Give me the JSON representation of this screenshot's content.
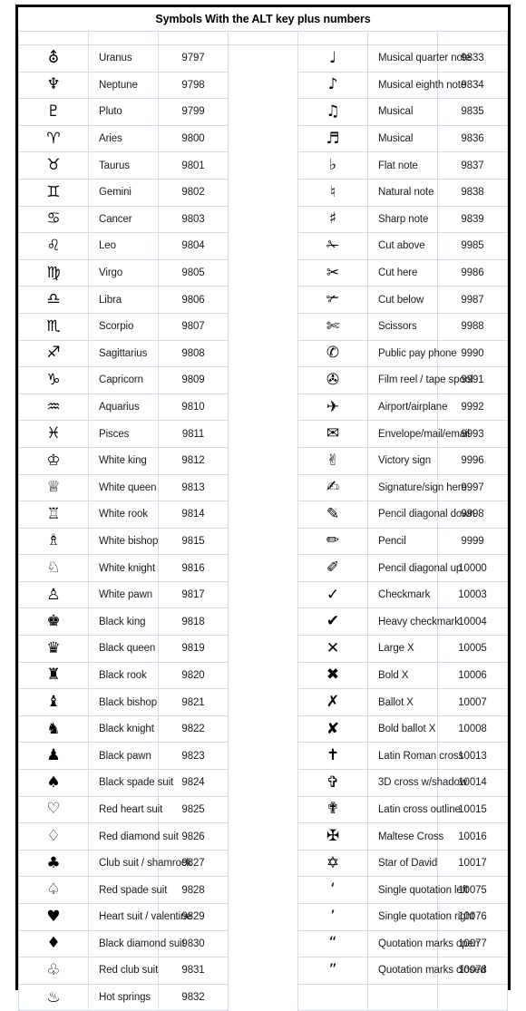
{
  "title": "Symbols With the ALT key plus numbers",
  "colors": {
    "frame": "#000000",
    "grid": "#d6dce5",
    "text": "#1a1a1a",
    "background": "#ffffff"
  },
  "columns": {
    "symbol_header": "",
    "name_header": "",
    "code_header": ""
  },
  "left_rows": [
    {
      "glyph": "⛢",
      "name": "Uranus",
      "code": "9797"
    },
    {
      "glyph": "♆",
      "name": "Neptune",
      "code": "9798"
    },
    {
      "glyph": "♇",
      "name": "Pluto",
      "code": "9799"
    },
    {
      "glyph": "♈",
      "name": "Aries",
      "code": "9800"
    },
    {
      "glyph": "♉",
      "name": "Taurus",
      "code": "9801"
    },
    {
      "glyph": "♊",
      "name": "Gemini",
      "code": "9802"
    },
    {
      "glyph": "♋",
      "name": "Cancer",
      "code": "9803"
    },
    {
      "glyph": "♌",
      "name": "Leo",
      "code": "9804"
    },
    {
      "glyph": "♍",
      "name": "Virgo",
      "code": "9805"
    },
    {
      "glyph": "♎",
      "name": "Libra",
      "code": "9806"
    },
    {
      "glyph": "♏",
      "name": "Scorpio",
      "code": "9807"
    },
    {
      "glyph": "♐",
      "name": "Sagittarius",
      "code": "9808"
    },
    {
      "glyph": "♑",
      "name": "Capricorn",
      "code": "9809"
    },
    {
      "glyph": "♒",
      "name": "Aquarius",
      "code": "9810"
    },
    {
      "glyph": "♓",
      "name": "Pisces",
      "code": "9811"
    },
    {
      "glyph": "♔",
      "name": "White king",
      "code": "9812"
    },
    {
      "glyph": "♕",
      "name": "White queen",
      "code": "9813"
    },
    {
      "glyph": "♖",
      "name": "White rook",
      "code": "9814"
    },
    {
      "glyph": "♗",
      "name": "White bishop",
      "code": "9815"
    },
    {
      "glyph": "♘",
      "name": "White knight",
      "code": "9816"
    },
    {
      "glyph": "♙",
      "name": "White pawn",
      "code": "9817"
    },
    {
      "glyph": "♚",
      "name": "Black king",
      "code": "9818"
    },
    {
      "glyph": "♛",
      "name": "Black queen",
      "code": "9819"
    },
    {
      "glyph": "♜",
      "name": "Black rook",
      "code": "9820"
    },
    {
      "glyph": "♝",
      "name": "Black bishop",
      "code": "9821"
    },
    {
      "glyph": "♞",
      "name": "Black knight",
      "code": "9822"
    },
    {
      "glyph": "♟",
      "name": "Black pawn",
      "code": "9823"
    },
    {
      "glyph": "♠",
      "name": "Black spade suit",
      "code": "9824"
    },
    {
      "glyph": "♡",
      "name": "Red heart suit",
      "code": "9825"
    },
    {
      "glyph": "♢",
      "name": "Red diamond suit",
      "code": "9826"
    },
    {
      "glyph": "♣",
      "name": "Club suit / shamrock",
      "code": "9827"
    },
    {
      "glyph": "♤",
      "name": "Red spade suit",
      "code": "9828"
    },
    {
      "glyph": "♥",
      "name": "Heart suit / valentine",
      "code": "9829"
    },
    {
      "glyph": "♦",
      "name": "Black diamond suit",
      "code": "9830"
    },
    {
      "glyph": "♧",
      "name": "Red club suit",
      "code": "9831"
    },
    {
      "glyph": "♨",
      "name": "Hot springs",
      "code": "9832"
    }
  ],
  "right_rows": [
    {
      "glyph": "♩",
      "name": "Musical quarter note",
      "code": "9833"
    },
    {
      "glyph": "♪",
      "name": "Musical eighth note",
      "code": "9834"
    },
    {
      "glyph": "♫",
      "name": "Musical",
      "code": "9835"
    },
    {
      "glyph": "♬",
      "name": "Musical",
      "code": "9836"
    },
    {
      "glyph": "♭",
      "name": "Flat note",
      "code": "9837"
    },
    {
      "glyph": "♮",
      "name": "Natural note",
      "code": "9838"
    },
    {
      "glyph": "♯",
      "name": "Sharp note",
      "code": "9839"
    },
    {
      "glyph": "✁",
      "name": "Cut above",
      "code": "9985"
    },
    {
      "glyph": "✂",
      "name": "Cut here",
      "code": "9986"
    },
    {
      "glyph": "✃",
      "name": "Cut below",
      "code": "9987"
    },
    {
      "glyph": "✄",
      "name": "Scissors",
      "code": "9988"
    },
    {
      "glyph": "✆",
      "name": "Public pay phone",
      "code": "9990"
    },
    {
      "glyph": "✇",
      "name": "Film reel / tape spool",
      "code": "9991"
    },
    {
      "glyph": "✈",
      "name": "Airport/airplane",
      "code": "9992"
    },
    {
      "glyph": "✉",
      "name": "Envelope/mail/email",
      "code": "9993"
    },
    {
      "glyph": "✌",
      "name": "Victory sign",
      "code": "9996"
    },
    {
      "glyph": "✍",
      "name": "Signature/sign here",
      "code": "9997"
    },
    {
      "glyph": "✎",
      "name": "Pencil diagonal down",
      "code": "9998"
    },
    {
      "glyph": "✏",
      "name": "Pencil",
      "code": "9999"
    },
    {
      "glyph": "✐",
      "name": "Pencil diagonal up",
      "code": "10000"
    },
    {
      "glyph": "✓",
      "name": "Checkmark",
      "code": "10003"
    },
    {
      "glyph": "✔",
      "name": "Heavy checkmark",
      "code": "10004"
    },
    {
      "glyph": "✕",
      "name": "Large X",
      "code": "10005"
    },
    {
      "glyph": "✖",
      "name": "Bold X",
      "code": "10006"
    },
    {
      "glyph": "✗",
      "name": "Ballot X",
      "code": "10007"
    },
    {
      "glyph": "✘",
      "name": "Bold ballot X",
      "code": "10008"
    },
    {
      "glyph": "✝",
      "name": "Latin Roman cross",
      "code": "10013"
    },
    {
      "glyph": "✞",
      "name": "3D cross w/shadow",
      "code": "10014"
    },
    {
      "glyph": "✟",
      "name": "Latin cross outline",
      "code": "10015"
    },
    {
      "glyph": "✠",
      "name": "Maltese Cross",
      "code": "10016"
    },
    {
      "glyph": "✡",
      "name": "Star of David",
      "code": "10017"
    },
    {
      "glyph": "‘",
      "name": "Single quotation left",
      "code": "10075"
    },
    {
      "glyph": "’",
      "name": "Single quotation right",
      "code": "10076"
    },
    {
      "glyph": "“",
      "name": "Quotation marks open",
      "code": "10077"
    },
    {
      "glyph": "”",
      "name": "Quotation marks closed",
      "code": "10078"
    },
    {
      "glyph": "",
      "name": "",
      "code": ""
    }
  ]
}
